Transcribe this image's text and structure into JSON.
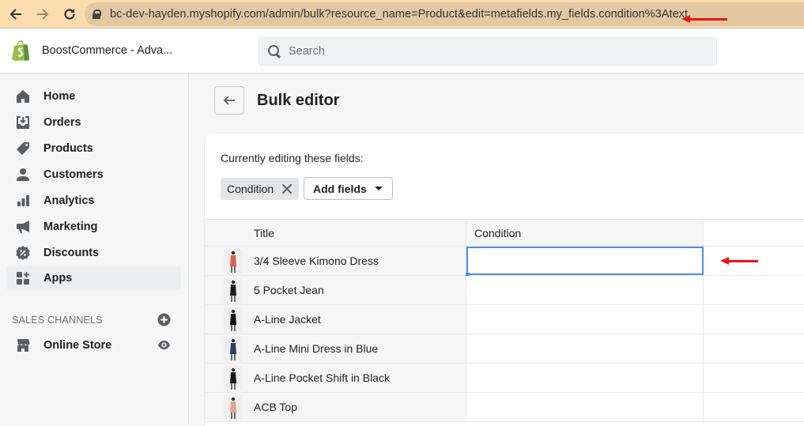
{
  "browser": {
    "url": "bc-dev-hayden.myshopify.com/admin/bulk?resource_name=Product&edit=metafields.my_fields.condition%3Atext",
    "annotation_color": "#ee1111"
  },
  "topbar": {
    "store_name": "BoostCommerce - Adva...",
    "search_placeholder": "Search",
    "brand_color": "#95bf47"
  },
  "sidebar": {
    "items": [
      {
        "label": "Home",
        "icon": "home-icon"
      },
      {
        "label": "Orders",
        "icon": "orders-icon"
      },
      {
        "label": "Products",
        "icon": "tag-icon"
      },
      {
        "label": "Customers",
        "icon": "person-icon"
      },
      {
        "label": "Analytics",
        "icon": "bar-chart-icon"
      },
      {
        "label": "Marketing",
        "icon": "megaphone-icon"
      },
      {
        "label": "Discounts",
        "icon": "discount-icon"
      },
      {
        "label": "Apps",
        "icon": "apps-icon",
        "active": true
      }
    ],
    "sales_channels_title": "SALES CHANNELS",
    "channels": [
      {
        "label": "Online Store",
        "icon": "store-icon"
      }
    ]
  },
  "page": {
    "title": "Bulk editor",
    "editing_label": "Currently editing these fields:",
    "fields": [
      {
        "label": "Condition"
      }
    ],
    "add_fields_label": "Add fields"
  },
  "grid": {
    "columns": [
      "Title",
      "Condition"
    ],
    "rows": [
      {
        "title": "3/4 Sleeve Kimono Dress",
        "condition": "",
        "selected": true,
        "thumb_color": "#e0604a"
      },
      {
        "title": "5 Pocket Jean",
        "condition": "",
        "thumb_color": "#1e1e1e"
      },
      {
        "title": "A-Line Jacket",
        "condition": "",
        "thumb_color": "#141414"
      },
      {
        "title": "A-Line Mini Dress in Blue",
        "condition": "",
        "thumb_color": "#2b3d6b"
      },
      {
        "title": "A-Line Pocket Shift in Black",
        "condition": "",
        "thumb_color": "#181818"
      },
      {
        "title": "ACB Top",
        "condition": "",
        "thumb_color": "#e0a58e"
      }
    ]
  }
}
